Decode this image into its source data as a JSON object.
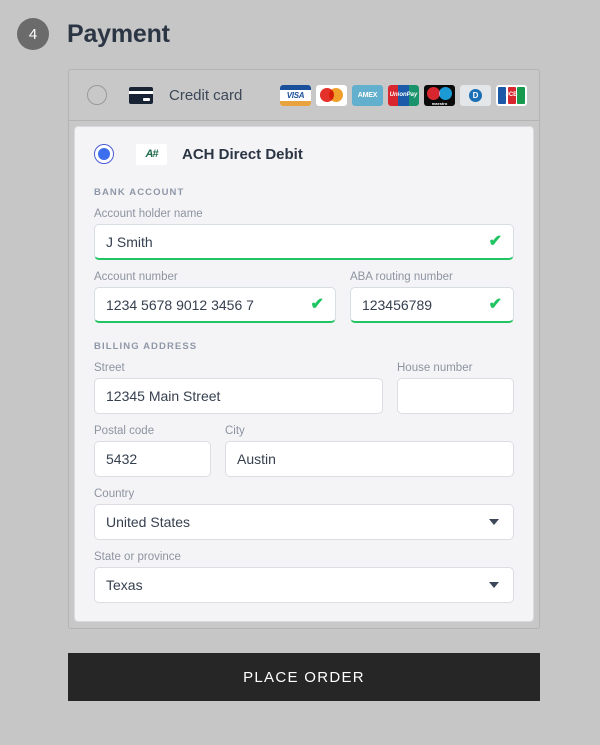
{
  "header": {
    "step_number": "4",
    "title": "Payment"
  },
  "payment_methods": {
    "credit_card": {
      "label": "Credit card",
      "selected": false,
      "icon": "credit-card-icon",
      "brands": [
        {
          "id": "visa",
          "label": "VISA"
        },
        {
          "id": "mastercard",
          "label": ""
        },
        {
          "id": "amex",
          "label": "AMEX"
        },
        {
          "id": "unionpay",
          "label": "UnionPay"
        },
        {
          "id": "maestro",
          "label": "maestro"
        },
        {
          "id": "diners",
          "label": "D"
        },
        {
          "id": "jcb",
          "label": "JCB"
        }
      ]
    },
    "ach": {
      "label": "ACH Direct Debit",
      "selected": true,
      "logo_text": "A#",
      "sections": {
        "bank_account": {
          "heading": "BANK ACCOUNT",
          "fields": {
            "account_holder_name": {
              "label": "Account holder name",
              "value": "J Smith",
              "valid": true
            },
            "account_number": {
              "label": "Account number",
              "value": "1234 5678 9012 3456 7",
              "valid": true
            },
            "aba_routing_number": {
              "label": "ABA routing number",
              "value": "123456789",
              "valid": true
            }
          }
        },
        "billing_address": {
          "heading": "BILLING ADDRESS",
          "fields": {
            "street": {
              "label": "Street",
              "value": "12345 Main Street"
            },
            "house_number": {
              "label": "House number",
              "value": ""
            },
            "postal_code": {
              "label": "Postal code",
              "value": "5432"
            },
            "city": {
              "label": "City",
              "value": "Austin"
            },
            "country": {
              "label": "Country",
              "value": "United States"
            },
            "state_or_province": {
              "label": "State or province",
              "value": "Texas"
            }
          }
        }
      }
    }
  },
  "footer": {
    "place_order_label": "PLACE ORDER"
  },
  "colors": {
    "page_background": "#c6c6c6",
    "accent_radio": "#3d6ef0",
    "valid_green": "#21c462",
    "button_dark": "#262626",
    "title_text": "#2b3544"
  }
}
